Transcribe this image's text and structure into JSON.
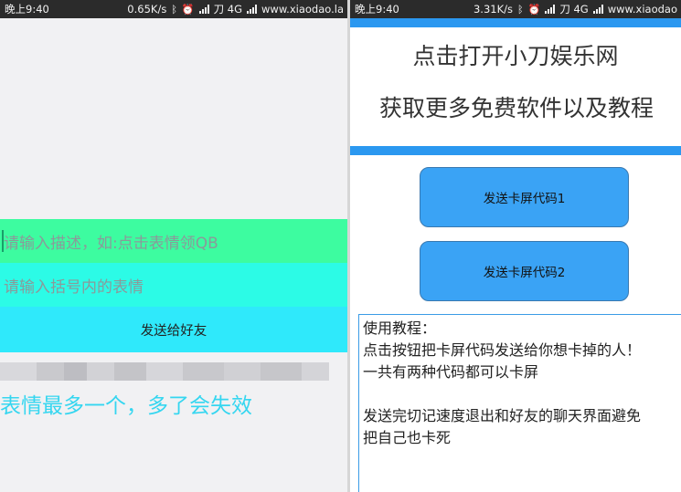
{
  "left_screen": {
    "status_bar": {
      "time": "晚上9:40",
      "speed": "0.65K/s",
      "carrier": "刀 4G",
      "site": "www.xiaodao.la"
    },
    "description_input": {
      "placeholder": "请输入描述，如:点击表情领QB"
    },
    "emoji_input": {
      "placeholder": "请输入括号内的表情"
    },
    "send_button": "发送给好友",
    "warning_text": "表情最多一个，多了会失效"
  },
  "right_screen": {
    "status_bar": {
      "time": "晚上9:40",
      "speed": "3.31K/s",
      "carrier": "刀 4G",
      "site": "www.xiaodao"
    },
    "link_line_1": "点击打开小刀娱乐网",
    "link_line_2": "获取更多免费软件以及教程",
    "button_1": "发送卡屏代码1",
    "button_2": "发送卡屏代码2",
    "tutorial": {
      "lines": [
        "使用教程：",
        "点击按钮把卡屏代码发送给你想卡掉的人！",
        "一共有两种代码都可以卡屏",
        "",
        "发送完切记速度退出和好友的聊天界面避免",
        "把自己也卡死"
      ]
    }
  },
  "colors": {
    "status_bar": "#2b2b2b",
    "description_bg": "#3dfca0",
    "emoji_bg": "#2cfbe6",
    "send_bg": "#2fe9fb",
    "warning_text": "#35d6f0",
    "accent_blue": "#2b98f0",
    "button_blue": "#3aa3f5"
  },
  "icons": [
    "bluetooth-icon",
    "alarm-icon",
    "signal-icon"
  ]
}
